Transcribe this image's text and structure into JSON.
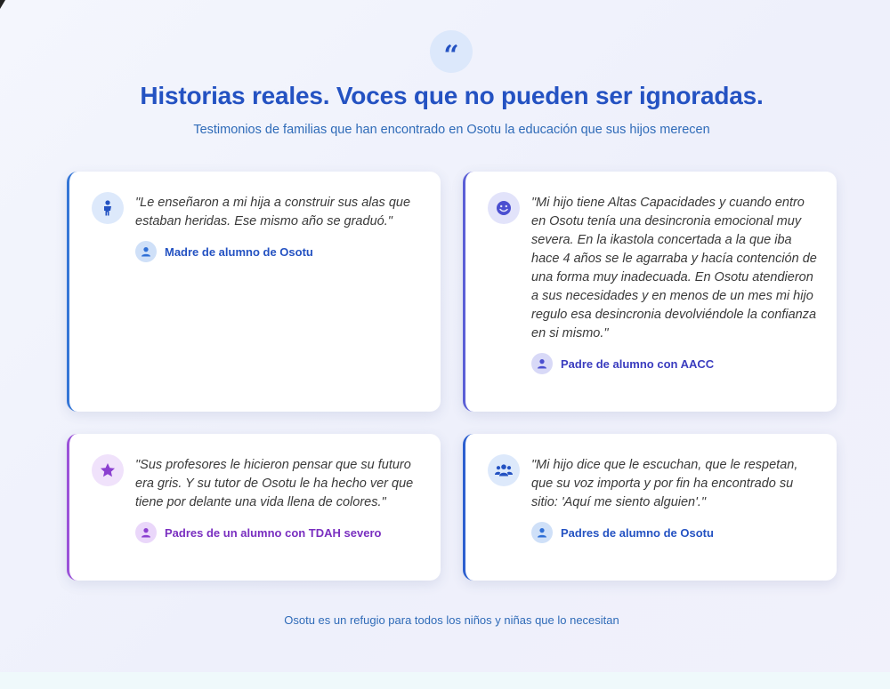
{
  "header": {
    "quote_icon": "quote-icon",
    "quote_glyph": "“",
    "title": "Historias reales. Voces que no pueden ser ignoradas.",
    "subtitle": "Testimonios de familias que han encontrado en Osotu la educación que sus hijos merecen"
  },
  "testimonials": [
    {
      "icon": "child-icon",
      "quote": "\"Le enseñaron a mi hija a construir sus alas que estaban heridas. Ese mismo año se graduó.\"",
      "author": "Madre de alumno de Osotu",
      "accent": "#3576d6"
    },
    {
      "icon": "smile-icon",
      "quote": "\"Mi hijo tiene Altas Capacidades y cuando entro en Osotu tenía una desincronia emocional muy severa. En la ikastola concertada a la que iba hace 4 años se le agarraba y hacía contención de una forma muy inadecuada. En Osotu atendieron a sus necesidades y en menos de un mes mi hijo regulo esa desincronia devolviéndole la confianza en si mismo.\"",
      "author": "Padre de alumno con AACC",
      "accent": "#5b5fd6"
    },
    {
      "icon": "star-icon",
      "quote": "\"Sus profesores le hicieron pensar que su futuro era gris. Y su tutor de Osotu le ha hecho ver que tiene por delante una vida llena de colores.\"",
      "author": "Padres de un alumno con TDAH severo",
      "accent": "#9b52d8"
    },
    {
      "icon": "users-icon",
      "quote": "\"Mi hijo dice que le escuchan, que le respetan, que su voz importa y por fin ha encontrado su sitio: 'Aquí me siento alguien'.\"",
      "author": "Padres de alumno de Osotu",
      "accent": "#2c5fcf"
    }
  ],
  "footer": {
    "note": "Osotu es un refugio para todos los niños y niñas que lo necesitan"
  }
}
